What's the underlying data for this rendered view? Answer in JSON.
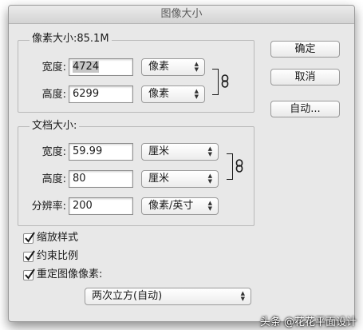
{
  "window": {
    "title": "图像大小"
  },
  "pixel_dimensions": {
    "title": "像素大小:85.1M",
    "width": {
      "label": "宽度:",
      "value": "4724",
      "unit": "像素"
    },
    "height": {
      "label": "高度:",
      "value": "6299",
      "unit": "像素"
    }
  },
  "document_size": {
    "title": "文档大小:",
    "width": {
      "label": "宽度:",
      "value": "59.99",
      "unit": "厘米"
    },
    "height": {
      "label": "高度:",
      "value": "80",
      "unit": "厘米"
    },
    "resolution": {
      "label": "分辨率:",
      "value": "200",
      "unit": "像素/英寸"
    }
  },
  "options": {
    "scale_styles": {
      "label": "缩放样式",
      "checked": true
    },
    "constrain_proportions": {
      "label": "约束比例",
      "checked": true
    },
    "resample": {
      "label": "重定图像像素:",
      "checked": true
    },
    "method": "两次立方(自动)"
  },
  "buttons": {
    "ok": "确定",
    "cancel": "取消",
    "auto": "自动..."
  },
  "watermark": "头条 @花花平面设计"
}
